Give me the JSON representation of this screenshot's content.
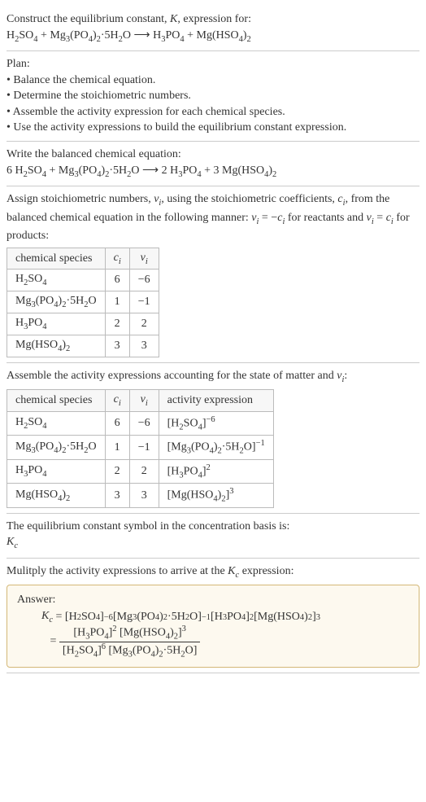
{
  "intro": {
    "line1": "Construct the equilibrium constant, K, expression for:",
    "line2": "H₂SO₄ + Mg₃(PO₄)₂·5H₂O ⟶ H₃PO₄ + Mg(HSO₄)₂"
  },
  "plan": {
    "title": "Plan:",
    "items": [
      "• Balance the chemical equation.",
      "• Determine the stoichiometric numbers.",
      "• Assemble the activity expression for each chemical species.",
      "• Use the activity expressions to build the equilibrium constant expression."
    ]
  },
  "balanced": {
    "title": "Write the balanced chemical equation:",
    "equation": "6 H₂SO₄ + Mg₃(PO₄)₂·5H₂O ⟶ 2 H₃PO₄ + 3 Mg(HSO₄)₂"
  },
  "assign": {
    "text": "Assign stoichiometric numbers, νᵢ, using the stoichiometric coefficients, cᵢ, from the balanced chemical equation in the following manner: νᵢ = −cᵢ for reactants and νᵢ = cᵢ for products:",
    "headers": [
      "chemical species",
      "cᵢ",
      "νᵢ"
    ],
    "rows": [
      [
        "H₂SO₄",
        "6",
        "−6"
      ],
      [
        "Mg₃(PO₄)₂·5H₂O",
        "1",
        "−1"
      ],
      [
        "H₃PO₄",
        "2",
        "2"
      ],
      [
        "Mg(HSO₄)₂",
        "3",
        "3"
      ]
    ]
  },
  "activity": {
    "text": "Assemble the activity expressions accounting for the state of matter and νᵢ:",
    "headers": [
      "chemical species",
      "cᵢ",
      "νᵢ",
      "activity expression"
    ],
    "rows": [
      [
        "H₂SO₄",
        "6",
        "−6",
        "[H₂SO₄]⁻⁶"
      ],
      [
        "Mg₃(PO₄)₂·5H₂O",
        "1",
        "−1",
        "[Mg₃(PO₄)₂·5H₂O]⁻¹"
      ],
      [
        "H₃PO₄",
        "2",
        "2",
        "[H₃PO₄]²"
      ],
      [
        "Mg(HSO₄)₂",
        "3",
        "3",
        "[Mg(HSO₄)₂]³"
      ]
    ]
  },
  "symbol": {
    "line1": "The equilibrium constant symbol in the concentration basis is:",
    "line2": "K_c"
  },
  "multiply": {
    "text": "Mulitply the activity expressions to arrive at the K_c expression:"
  },
  "answer": {
    "label": "Answer:",
    "kc_prefix": "K_c = ",
    "expr1": "[H₂SO₄]⁻⁶ [Mg₃(PO₄)₂·5H₂O]⁻¹ [H₃PO₄]² [Mg(HSO₄)₂]³",
    "eq_prefix": "= ",
    "numerator": "[H₃PO₄]² [Mg(HSO₄)₂]³",
    "denominator": "[H₂SO₄]⁶ [Mg₃(PO₄)₂·5H₂O]"
  }
}
